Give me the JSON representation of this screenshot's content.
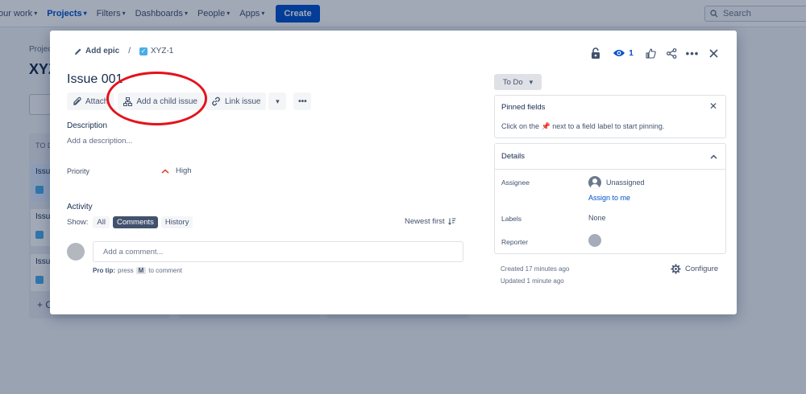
{
  "nav": {
    "items": [
      "our work",
      "Projects",
      "Filters",
      "Dashboards",
      "People",
      "Apps"
    ],
    "create_label": "Create",
    "search_placeholder": "Search"
  },
  "background": {
    "breadcrumb": "Project",
    "title": "XYZ",
    "column_header": "TO D",
    "cards": [
      "Issu",
      "Issu",
      "Issu"
    ],
    "create_label": "+ C"
  },
  "modal": {
    "breadcrumb": {
      "epic_label": "Add epic",
      "separator": "/",
      "issue_key": "XYZ-1"
    },
    "watch_count": "1",
    "title": "Issue 001",
    "toolbar": {
      "attach": "Attach",
      "add_child": "Add a child issue",
      "link_issue": "Link issue"
    },
    "description_label": "Description",
    "description_placeholder": "Add a description...",
    "priority_label": "Priority",
    "priority_value": "High",
    "activity": {
      "title": "Activity",
      "show_label": "Show:",
      "filters": [
        "All",
        "Comments",
        "History"
      ],
      "active_filter": "Comments",
      "sort_label": "Newest first",
      "comment_placeholder": "Add a comment...",
      "protip_bold": "Pro tip:",
      "protip_pre": "press",
      "protip_key": "M",
      "protip_post": "to comment"
    },
    "status": "To Do",
    "pinned": {
      "title": "Pinned fields",
      "text_pre": "Click on the",
      "text_post": "next to a field label to start pinning."
    },
    "details": {
      "title": "Details",
      "assignee_label": "Assignee",
      "assignee_value": "Unassigned",
      "assign_to_me": "Assign to me",
      "labels_label": "Labels",
      "labels_value": "None",
      "reporter_label": "Reporter"
    },
    "created": "Created 17 minutes ago",
    "updated": "Updated 1 minute ago",
    "configure_label": "Configure"
  },
  "colors": {
    "accent": "#0052cc",
    "annotation_circle": "#e5121c"
  }
}
